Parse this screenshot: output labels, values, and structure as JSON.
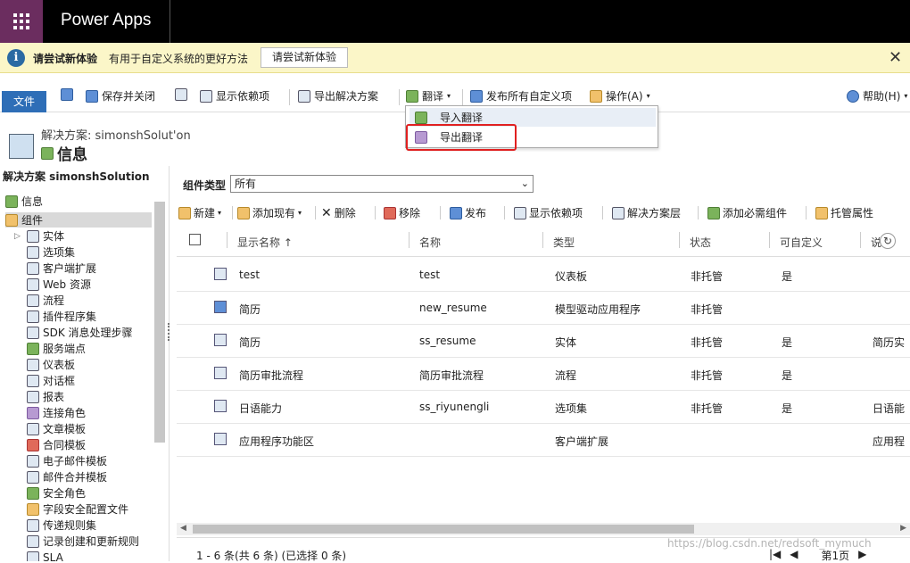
{
  "app": {
    "title": "Power Apps"
  },
  "notice": {
    "title": "请尝试新体验",
    "text": "有用于自定义系统的更好方法",
    "button": "请尝试新体验",
    "close": "✕"
  },
  "ribbon": {
    "file": "文件",
    "save_close": "保存并关闭",
    "show_deps": "显示依赖项",
    "export_solution": "导出解决方案",
    "translate": "翻译",
    "publish_all": "发布所有自定义项",
    "actions": "操作(A)",
    "help": "帮助(H)"
  },
  "translate_menu": {
    "import": "导入翻译",
    "export": "导出翻译"
  },
  "crumb": {
    "solution": "解决方案: simonshSolut'on",
    "title": "信息"
  },
  "sidebar": {
    "header": "解决方案 simonshSolution",
    "items": [
      {
        "label": "信息",
        "icon": "info-icon"
      },
      {
        "label": "组件",
        "icon": "components-icon"
      },
      {
        "label": "实体",
        "icon": "entity-icon"
      },
      {
        "label": "选项集",
        "icon": "optionset-icon"
      },
      {
        "label": "客户端扩展",
        "icon": "client-ext-icon"
      },
      {
        "label": "Web 资源",
        "icon": "webres-icon"
      },
      {
        "label": "流程",
        "icon": "process-icon"
      },
      {
        "label": "插件程序集",
        "icon": "plugin-icon"
      },
      {
        "label": "SDK 消息处理步骤",
        "icon": "sdk-icon"
      },
      {
        "label": "服务端点",
        "icon": "endpoint-icon"
      },
      {
        "label": "仪表板",
        "icon": "dashboard-icon"
      },
      {
        "label": "对话框",
        "icon": "dialog-icon"
      },
      {
        "label": "报表",
        "icon": "report-icon"
      },
      {
        "label": "连接角色",
        "icon": "connrole-icon"
      },
      {
        "label": "文章模板",
        "icon": "article-icon"
      },
      {
        "label": "合同模板",
        "icon": "contract-icon"
      },
      {
        "label": "电子邮件模板",
        "icon": "email-icon"
      },
      {
        "label": "邮件合并模板",
        "icon": "mailmerge-icon"
      },
      {
        "label": "安全角色",
        "icon": "secrole-icon"
      },
      {
        "label": "字段安全配置文件",
        "icon": "fieldsec-icon"
      },
      {
        "label": "传递规则集",
        "icon": "routing-icon"
      },
      {
        "label": "记录创建和更新规则",
        "icon": "rules-icon"
      },
      {
        "label": "SLA",
        "icon": "sla-icon"
      }
    ]
  },
  "filter": {
    "label": "组件类型",
    "value": "所有"
  },
  "gridbar": {
    "new": "新建",
    "add_existing": "添加现有",
    "delete": "删除",
    "remove": "移除",
    "publish": "发布",
    "show_deps": "显示依赖项",
    "layers": "解决方案层",
    "add_required": "添加必需组件",
    "managed_props": "托管属性"
  },
  "table": {
    "columns": [
      "显示名称 ↑",
      "名称",
      "类型",
      "状态",
      "可自定义",
      "说"
    ],
    "rows": [
      [
        "test",
        "test",
        "仪表板",
        "非托管",
        "是",
        ""
      ],
      [
        "简历",
        "new_resume",
        "模型驱动应用程序",
        "非托管",
        "",
        ""
      ],
      [
        "简历",
        "ss_resume",
        "实体",
        "非托管",
        "是",
        "简历实"
      ],
      [
        "简历审批流程",
        "简历审批流程",
        "流程",
        "非托管",
        "是",
        ""
      ],
      [
        "日语能力",
        "ss_riyunengli",
        "选项集",
        "非托管",
        "是",
        "日语能"
      ],
      [
        "应用程序功能区",
        "",
        "客户端扩展",
        "",
        "",
        "应用程"
      ]
    ]
  },
  "footer": {
    "status": "1 - 6 条(共 6 条) (已选择 0 条)",
    "page": "第1页"
  },
  "watermark": "https://blog.csdn.net/redsoft_mymuch"
}
